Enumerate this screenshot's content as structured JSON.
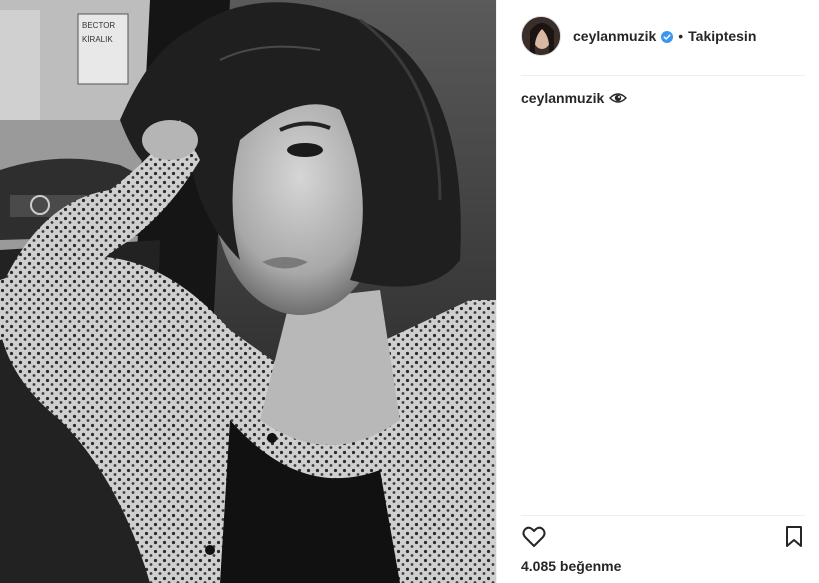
{
  "post": {
    "username": "ceylanmuzik",
    "follow_status": "Takiptesin",
    "separator": "•",
    "caption_user": "ceylanmuzik",
    "likes_text": "4.085 beğenme"
  },
  "photo": {
    "sign_text_1": "BECTOR",
    "sign_text_2": "KİRALIK"
  },
  "icons": {
    "verified": "verified-badge-icon",
    "eye": "eye-icon",
    "like": "heart-icon",
    "save": "bookmark-icon"
  },
  "colors": {
    "verified_blue": "#3897f0",
    "text": "#262626",
    "divider": "#efefef"
  }
}
